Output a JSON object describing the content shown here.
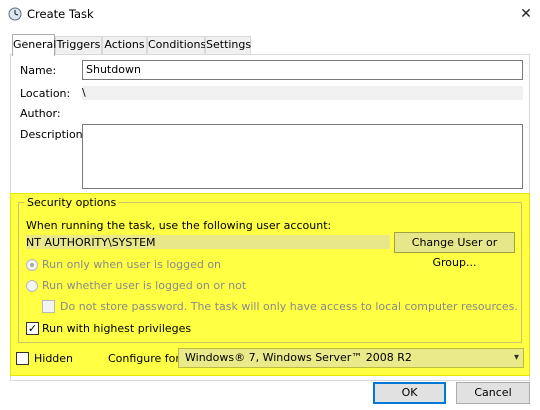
{
  "window": {
    "title": "Create Task",
    "close_glyph": "✕"
  },
  "tabs": [
    {
      "label": "General",
      "active": true
    },
    {
      "label": "Triggers",
      "active": false
    },
    {
      "label": "Actions",
      "active": false
    },
    {
      "label": "Conditions",
      "active": false
    },
    {
      "label": "Settings",
      "active": false
    }
  ],
  "general": {
    "name_label": "Name:",
    "name_value": "Shutdown",
    "location_label": "Location:",
    "location_value": "\\",
    "author_label": "Author:",
    "author_value": "",
    "description_label": "Description:",
    "description_value": ""
  },
  "security": {
    "legend": "Security options",
    "account_prompt": "When running the task, use the following user account:",
    "account_value": "NT AUTHORITY\\SYSTEM",
    "change_user_button": "Change User or Group...",
    "radio_logged_on": "Run only when user is logged on",
    "radio_logged_on_checked": true,
    "radio_whether": "Run whether user is logged on or not",
    "radio_whether_checked": false,
    "no_store_password": "Do not store password.  The task will only have access to local computer resources.",
    "no_store_password_checked": false,
    "highest_privileges": "Run with highest privileges",
    "highest_privileges_checked": true,
    "check_glyph": "✓"
  },
  "footer": {
    "hidden_label": "Hidden",
    "hidden_checked": false,
    "configure_label": "Configure for:",
    "configure_value": "Windows® 7, Windows Server™ 2008 R2",
    "ok_button": "OK",
    "cancel_button": "Cancel"
  },
  "colors": {
    "highlight": "#ffff44",
    "accent": "#0078d7"
  }
}
